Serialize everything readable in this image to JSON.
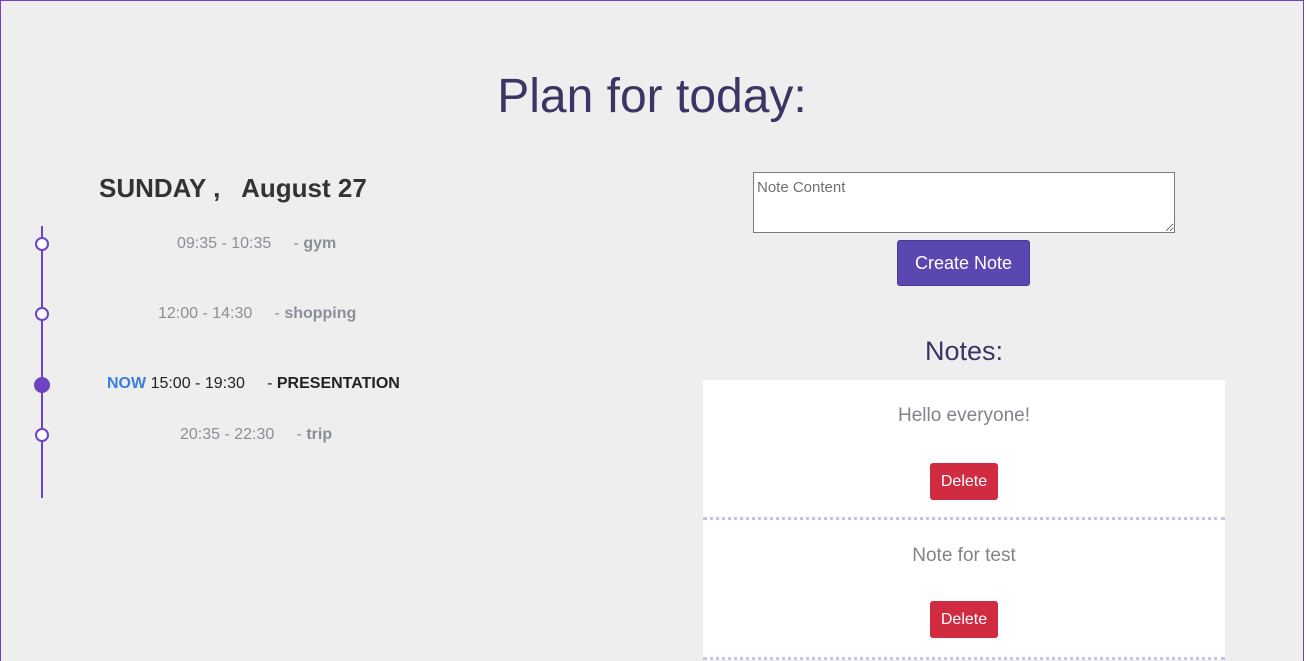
{
  "page": {
    "title": "Plan for today:"
  },
  "schedule": {
    "day": "SUNDAY ,",
    "date": "August 27",
    "events": [
      {
        "time": "09:35 - 10:35",
        "separator": "-",
        "title": "gym",
        "now": false
      },
      {
        "time": "12:00 - 14:30",
        "separator": "-",
        "title": "shopping",
        "now": false
      },
      {
        "time": "15:00 - 19:30",
        "separator": "-",
        "title": "PRESENTATION",
        "now": true,
        "now_label": "NOW"
      },
      {
        "time": "20:35 - 22:30",
        "separator": "-",
        "title": "trip",
        "now": false
      }
    ]
  },
  "note_form": {
    "placeholder": "Note Content",
    "value": "",
    "create_label": "Create Note"
  },
  "notes": {
    "heading": "Notes:",
    "items": [
      {
        "text": "Hello everyone!",
        "delete_label": "Delete"
      },
      {
        "text": "Note for test",
        "delete_label": "Delete"
      }
    ]
  },
  "colors": {
    "accent": "#6f42c1",
    "button_primary": "#5a48b0",
    "delete": "#d12b42",
    "now": "#3b7ddd",
    "heading": "#3a3564"
  }
}
